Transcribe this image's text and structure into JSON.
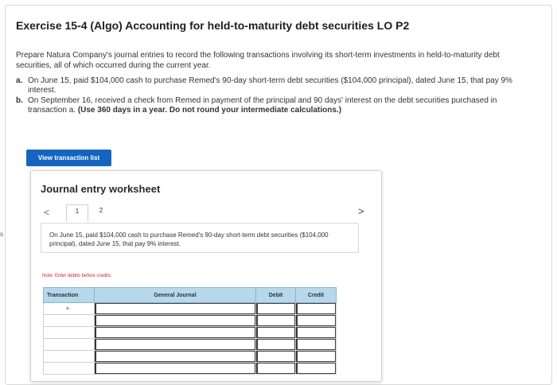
{
  "page": {
    "edge_mark": "s",
    "title": "Exercise 15-4 (Algo) Accounting for held-to-maturity debt securities LO P2",
    "intro": "Prepare Natura Company's journal entries to record the following transactions involving its short-term investments in held-to-maturity debt securities, all of which occurred during the current year.",
    "parts": [
      {
        "marker": "a.",
        "text": "On June 15, paid $104,000 cash to purchase Remed's 90-day short-term debt securities ($104,000 principal), dated June 15, that pay 9% interest.",
        "bold": ""
      },
      {
        "marker": "b.",
        "text": "On September 16, received a check from Remed in payment of the principal and 90 days' interest on the debt securities purchased in transaction a. ",
        "bold": "(Use 360 days in a year. Do not round your intermediate calculations.)"
      }
    ],
    "view_button": "View transaction list"
  },
  "worksheet": {
    "title": "Journal entry worksheet",
    "pager": {
      "prev": "<",
      "next": ">",
      "pages": [
        "1",
        "2"
      ],
      "active": 1
    },
    "description": "On June 15, paid $104,000 cash to purchase Remed's 90-day short-term debt securities ($104,000 principal), dated June 15, that pay 9% interest.",
    "note": "Note: Enter debits before credits.",
    "table": {
      "headers": {
        "transaction": "Transaction",
        "general_journal": "General Journal",
        "debit": "Debit",
        "credit": "Credit"
      },
      "rows": [
        {
          "transaction": "a.",
          "account": "",
          "debit": "",
          "credit": ""
        },
        {
          "transaction": "",
          "account": "",
          "debit": "",
          "credit": ""
        },
        {
          "transaction": "",
          "account": "",
          "debit": "",
          "credit": ""
        },
        {
          "transaction": "",
          "account": "",
          "debit": "",
          "credit": ""
        },
        {
          "transaction": "",
          "account": "",
          "debit": "",
          "credit": ""
        },
        {
          "transaction": "",
          "account": "",
          "debit": "",
          "credit": ""
        }
      ]
    }
  },
  "colors": {
    "button_blue": "#1565c0",
    "table_header": "#b7d8ea",
    "note_red": "#c62828"
  }
}
